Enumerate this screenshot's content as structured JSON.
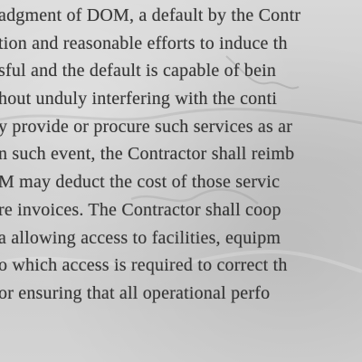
{
  "document": {
    "lines": [
      "adgment of DOM, a default by the Contr",
      "tion and reasonable efforts to induce th",
      "sful and the default is capable of bein",
      "hout unduly interfering with the conti",
      "y provide or procure such services as ar",
      "n such event, the Contractor shall reimb",
      "M may deduct the cost of those servic",
      "re invoices.  The Contractor shall coop",
      "a allowing access to facilities, equipm",
      "o which access is required to correct th",
      "or ensuring that all operational perfo",
      ""
    ]
  }
}
